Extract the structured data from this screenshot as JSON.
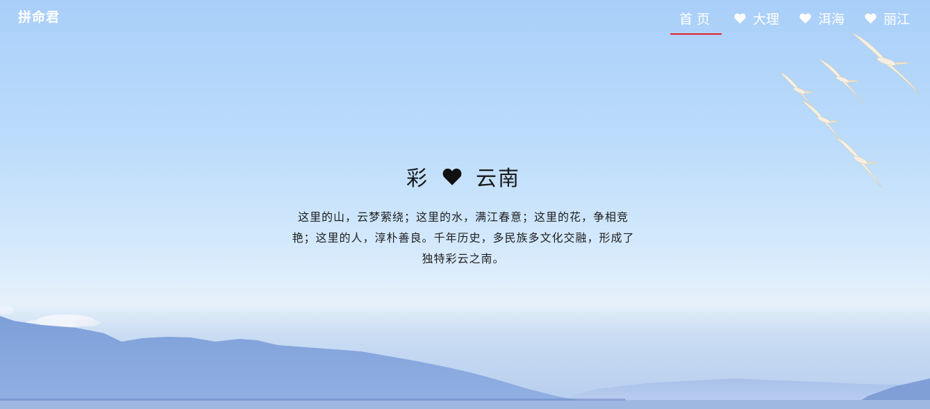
{
  "brand": "拼命君",
  "nav": [
    {
      "label": "首页",
      "icon": "",
      "active": true
    },
    {
      "label": "大理",
      "icon": "heart-icon",
      "active": false
    },
    {
      "label": "洱海",
      "icon": "heart-icon",
      "active": false
    },
    {
      "label": "丽江",
      "icon": "heart-icon",
      "active": false
    }
  ],
  "hero": {
    "title_left": "彩",
    "title_icon": "heart-icon",
    "title_right": "云南",
    "paragraph": "这里的山，云梦萦绕；这里的水，满江春意；这里的花，争相竞艳；这里的人，淳朴善良。千年历史，多民族多文化交融，形成了独特彩云之南。"
  },
  "colors": {
    "accent": "#e8202a",
    "nav_text": "#ffffff",
    "title_text": "#1a1a1a"
  }
}
